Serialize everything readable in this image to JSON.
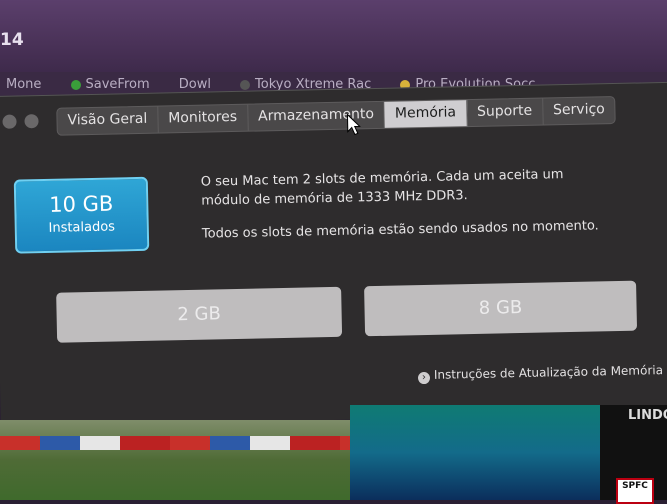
{
  "background": {
    "title_fragment": "14",
    "bookmarks": [
      "Mone",
      "SaveFrom",
      "Dowl",
      "Tokyo Xtreme Rac",
      "Pro Evolution Socc"
    ]
  },
  "window": {
    "tabs": [
      {
        "label": "Visão Geral",
        "active": false
      },
      {
        "label": "Monitores",
        "active": false
      },
      {
        "label": "Armazenamento",
        "active": false
      },
      {
        "label": "Memória",
        "active": true
      },
      {
        "label": "Suporte",
        "active": false
      },
      {
        "label": "Serviço",
        "active": false
      }
    ],
    "memory_badge": {
      "size": "10 GB",
      "label": "Instalados"
    },
    "info_line1": "O seu Mac tem 2 slots de memória. Cada um aceita um",
    "info_line2": "módulo de memória de 1333 MHz DDR3.",
    "info_line3": "Todos os slots de memória estão sendo usados no momento.",
    "slots": [
      "2 GB",
      "8 GB"
    ],
    "upgrade_link": "Instruções de Atualização da Memória"
  },
  "tv": {
    "corner_text": "LINDO",
    "logo_text": "SPFC"
  }
}
